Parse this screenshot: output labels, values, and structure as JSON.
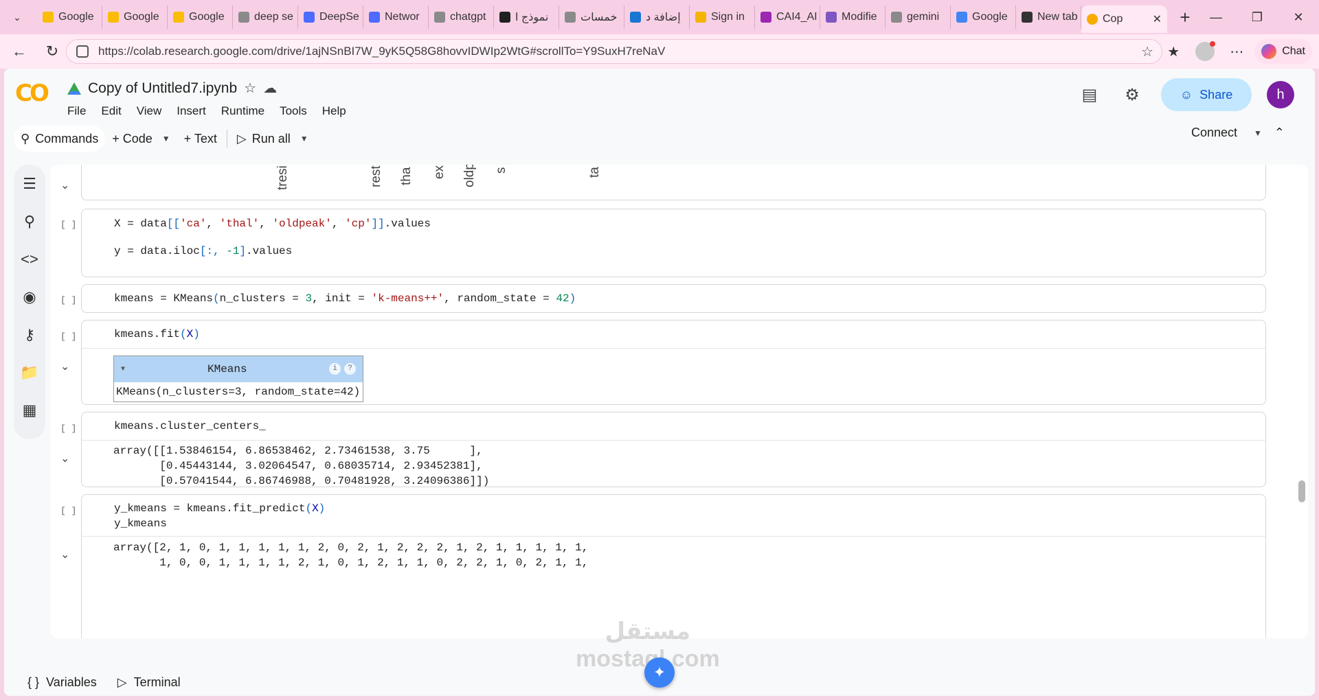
{
  "browser": {
    "tabs": [
      {
        "label": "Google",
        "color": "#fbbc05"
      },
      {
        "label": "Google",
        "color": "#fbbc05"
      },
      {
        "label": "Google",
        "color": "#fbbc05"
      },
      {
        "label": "deep se",
        "color": "#8a8a8a"
      },
      {
        "label": "DeepSe",
        "color": "#4d6bfe"
      },
      {
        "label": "Networ",
        "color": "#4d6bfe"
      },
      {
        "label": "chatgpt",
        "color": "#8a8a8a"
      },
      {
        "label": "نموذج ا",
        "color": "#202020"
      },
      {
        "label": "خمسات",
        "color": "#8a8a8a"
      },
      {
        "label": "إضافة د",
        "color": "#1976d2"
      },
      {
        "label": "Sign in",
        "color": "#f4b400"
      },
      {
        "label": "CAI4_AI",
        "color": "#9c27b0"
      },
      {
        "label": "Modifie",
        "color": "#7e57c2"
      },
      {
        "label": "gemini",
        "color": "#8a8a8a"
      },
      {
        "label": "Google",
        "color": "#4285f4"
      },
      {
        "label": "New tab",
        "color": "#333333"
      }
    ],
    "active_tab": {
      "label": "Cop",
      "close": "✕"
    },
    "url": "https://colab.research.google.com/drive/1ajNSnBI7W_9yK5Q58G8hovvIDWIp2WtG#scrollTo=Y9SuxH7reNaV",
    "chat_label": "Chat"
  },
  "colab": {
    "logo": "CO",
    "title": "Copy of Untitled7.ipynb",
    "menu": [
      "File",
      "Edit",
      "View",
      "Insert",
      "Runtime",
      "Tools",
      "Help"
    ],
    "share_label": "Share",
    "avatar_letter": "h",
    "toolbar": {
      "commands": "Commands",
      "code": "+ Code",
      "text": "+ Text",
      "run_all": "Run all",
      "connect": "Connect"
    },
    "bottom": {
      "variables": "Variables",
      "terminal": "Terminal"
    }
  },
  "rotated_labels": [
    "tresi",
    "rest",
    "tha",
    "ex",
    "oldp",
    "s",
    "ta"
  ],
  "cells": {
    "c1": {
      "line1_a": "X = data",
      "line1_b": "[[",
      "s1": "'ca'",
      "s2": "'thal'",
      "s3": "'oldpeak'",
      "s4": "'cp'",
      "line1_c": "]]",
      "line1_d": ".values",
      "line2_a": "y = data.iloc",
      "line2_b": "[:, ",
      "n1": "-1",
      "line2_c": "]",
      "line2_d": ".values",
      "comma": ", "
    },
    "c2": {
      "a": "kmeans = KMeans",
      "b": "(",
      "c": "n_clusters = ",
      "n": "3",
      "d": ", init = ",
      "s": "'k-means++'",
      "e": ", random_state = ",
      "n2": "42",
      "f": ")"
    },
    "c3": {
      "a": "kmeans.fit",
      "b": "(",
      "v": "X",
      "c": ")",
      "box_title": "KMeans",
      "box_body": "KMeans(n_clusters=3, random_state=42)",
      "info1": "i",
      "info2": "?"
    },
    "c4": {
      "code": "kmeans.cluster_centers_",
      "out": "array([[1.53846154, 6.86538462, 2.73461538, 3.75      ],\n       [0.45443144, 3.02064547, 0.68035714, 2.93452381],\n       [0.57041544, 6.86746988, 0.70481928, 3.24096386]])"
    },
    "c5": {
      "a": "y_kmeans = kmeans.fit_predict",
      "b": "(",
      "v": "X",
      "c": ")",
      "line2": "y_kmeans",
      "out": "array([2, 1, 0, 1, 1, 1, 1, 1, 2, 0, 2, 1, 2, 2, 2, 1, 2, 1, 1, 1, 1, 1,\n       1, 0, 0, 1, 1, 1, 1, 2, 1, 0, 1, 2, 1, 1, 0, 2, 2, 1, 0, 2, 1, 1,"
    }
  },
  "run_marker": "[ ]",
  "watermark": "مستقل\nmostaql.com"
}
